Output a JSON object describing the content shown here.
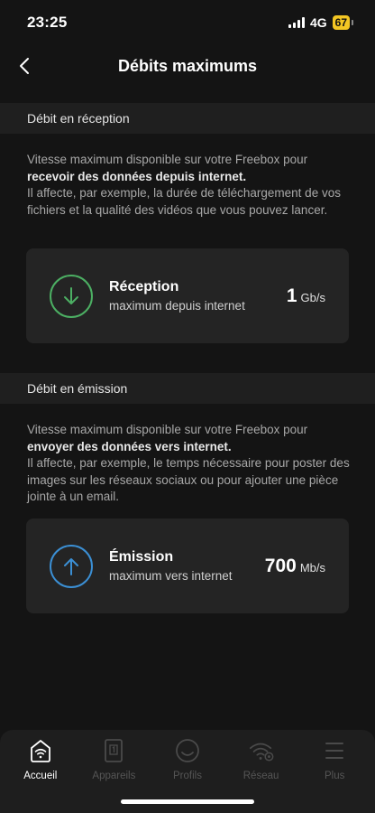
{
  "status_bar": {
    "time": "23:25",
    "network": "4G",
    "battery": "67"
  },
  "header": {
    "title": "Débits maximums"
  },
  "reception": {
    "section_title": "Débit en réception",
    "desc_intro": "Vitesse maximum disponible sur votre Freebox pour",
    "desc_bold": "recevoir des données depuis internet.",
    "desc_rest": "Il affecte, par exemple, la durée de téléchargement de vos fichiers et la qualité des vidéos que vous pouvez lancer.",
    "card_title": "Réception",
    "card_subtitle": "maximum depuis internet",
    "speed_value": "1",
    "speed_unit": "Gb/s",
    "icon": "arrow-down-icon",
    "accent_color": "#4caf63"
  },
  "emission": {
    "section_title": "Débit en émission",
    "desc_intro": "Vitesse maximum disponible sur votre Freebox pour",
    "desc_bold": "envoyer des données vers internet.",
    "desc_rest": "Il affecte, par exemple, le temps nécessaire pour poster des images sur les réseaux sociaux ou pour ajouter une pièce jointe à un email.",
    "card_title": "Émission",
    "card_subtitle": "maximum vers internet",
    "speed_value": "700",
    "speed_unit": "Mb/s",
    "icon": "arrow-up-icon",
    "accent_color": "#3b8fd4"
  },
  "tab_bar": {
    "items": [
      {
        "label": "Accueil",
        "icon": "home-wifi-icon",
        "active": true
      },
      {
        "label": "Appareils",
        "icon": "device-icon",
        "active": false
      },
      {
        "label": "Profils",
        "icon": "profile-icon",
        "active": false
      },
      {
        "label": "Réseau",
        "icon": "network-settings-icon",
        "active": false
      },
      {
        "label": "Plus",
        "icon": "menu-icon",
        "active": false
      }
    ]
  }
}
